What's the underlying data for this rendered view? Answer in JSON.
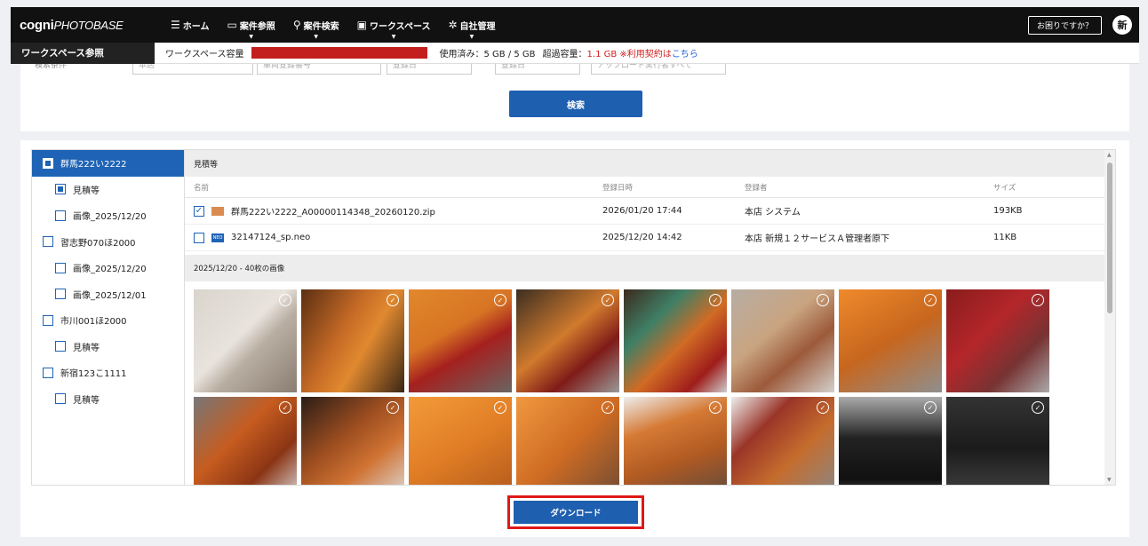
{
  "nav": {
    "logo_main": "cogni",
    "logo_sub": "PHOTOBASE",
    "items": [
      {
        "icon": "☰",
        "label": "ホーム"
      },
      {
        "icon": "▭",
        "label": "案件参照"
      },
      {
        "icon": "⚲",
        "label": "案件検索"
      },
      {
        "icon": "▣",
        "label": "ワークスペース"
      },
      {
        "icon": "✲",
        "label": "自社管理"
      }
    ],
    "help_label": "お困りですか？",
    "avatar": "新"
  },
  "subbar": {
    "title": "ワークスペース参照",
    "capacity_label": "ワークスペース容量",
    "used_text": "使用済み：5 GB / 5 GB",
    "over_label": "超過容量：",
    "over_value": "1.1 GB",
    "contract_prefix": "※利用契約は",
    "contract_link": "こちら",
    "bar_color": "#c41f1f"
  },
  "search": {
    "ghost_fields": [
      "検索条件",
      "本店",
      "車両登録番号",
      "登録日",
      "登録日",
      "アップロード実行者すべて"
    ],
    "search_button": "検索"
  },
  "tree": [
    {
      "label": "群馬222い2222",
      "level": 1,
      "selected": true,
      "state": "partial"
    },
    {
      "label": "見積等",
      "level": 2,
      "selected": false,
      "state": "partial"
    },
    {
      "label": "画像_2025/12/20",
      "level": 2,
      "selected": false,
      "state": "empty"
    },
    {
      "label": "習志野070ほ2000",
      "level": 1,
      "selected": false,
      "state": "empty"
    },
    {
      "label": "画像_2025/12/20",
      "level": 2,
      "selected": false,
      "state": "empty"
    },
    {
      "label": "画像_2025/12/01",
      "level": 2,
      "selected": false,
      "state": "empty"
    },
    {
      "label": "市川001ほ2000",
      "level": 1,
      "selected": false,
      "state": "empty"
    },
    {
      "label": "見積等",
      "level": 2,
      "selected": false,
      "state": "empty"
    },
    {
      "label": "新宿123こ1111",
      "level": 1,
      "selected": false,
      "state": "empty"
    },
    {
      "label": "見積等",
      "level": 2,
      "selected": false,
      "state": "empty"
    }
  ],
  "files": {
    "section_title": "見積等",
    "columns": {
      "name": "名前",
      "date": "登録日時",
      "user": "登録者",
      "size": "サイズ"
    },
    "rows": [
      {
        "checked": true,
        "type": "zip",
        "name": "群馬222い2222_A00000114348_20260120.zip",
        "date": "2026/01/20 17:44",
        "user": "本店 システム",
        "size": "193KB"
      },
      {
        "checked": false,
        "type": "neo",
        "name": "32147124_sp.neo",
        "date": "2025/12/20 14:42",
        "user": "本店 新規１２サービスＡ管理者原下",
        "size": "11KB"
      }
    ]
  },
  "photos": {
    "section_title": "2025/12/20 - 40枚の画像",
    "count_visible": 16
  },
  "download_button": "ダウンロード",
  "colors": {
    "primary": "#1e5fb0",
    "highlight": "#e01818",
    "nav_bg": "#111111"
  }
}
